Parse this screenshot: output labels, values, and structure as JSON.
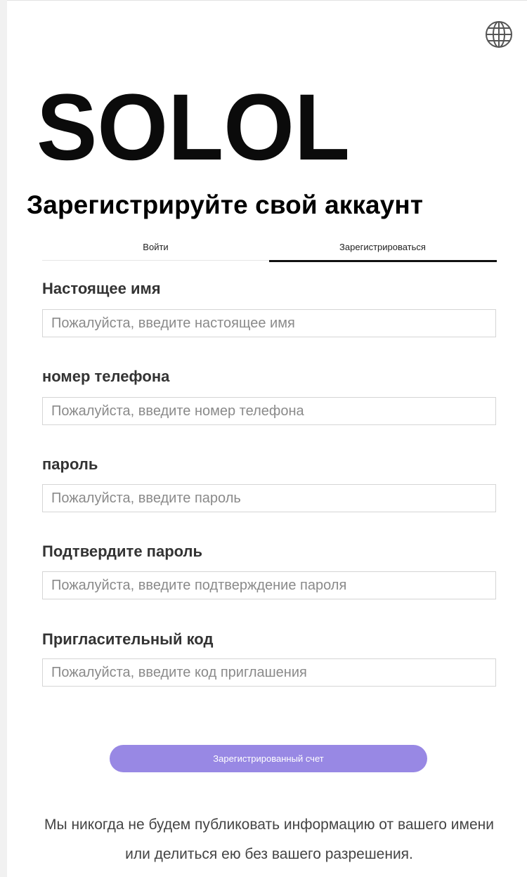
{
  "brand": {
    "logo_text": "SOLOL"
  },
  "header": {
    "language_icon": "globe-icon",
    "title": "Зарегистрируйте свой аккаунт"
  },
  "tabs": [
    {
      "label": "Войти",
      "active": false
    },
    {
      "label": "Зарегистрироваться",
      "active": true
    }
  ],
  "form": {
    "fields": [
      {
        "label": "Настоящее имя",
        "placeholder": "Пожалуйста, введите настоящее имя",
        "value": ""
      },
      {
        "label": "номер телефона",
        "placeholder": "Пожалуйста, введите номер телефона",
        "value": ""
      },
      {
        "label": "пароль",
        "placeholder": "Пожалуйста, введите пароль",
        "value": ""
      },
      {
        "label": "Подтвердите пароль",
        "placeholder": "Пожалуйста, введите подтверждение пароля",
        "value": ""
      },
      {
        "label": "Пригласительный код",
        "placeholder": "Пожалуйста, введите код приглашения",
        "value": ""
      }
    ],
    "submit_label": "Зарегистрированный счет"
  },
  "footer": {
    "disclaimer": "Мы никогда не будем публиковать информацию от вашего имени или делиться ею без вашего разрешения."
  },
  "colors": {
    "accent": "#9888e4",
    "text_dark": "#000000",
    "label_text": "#333333",
    "input_border": "#d5d5d5"
  }
}
